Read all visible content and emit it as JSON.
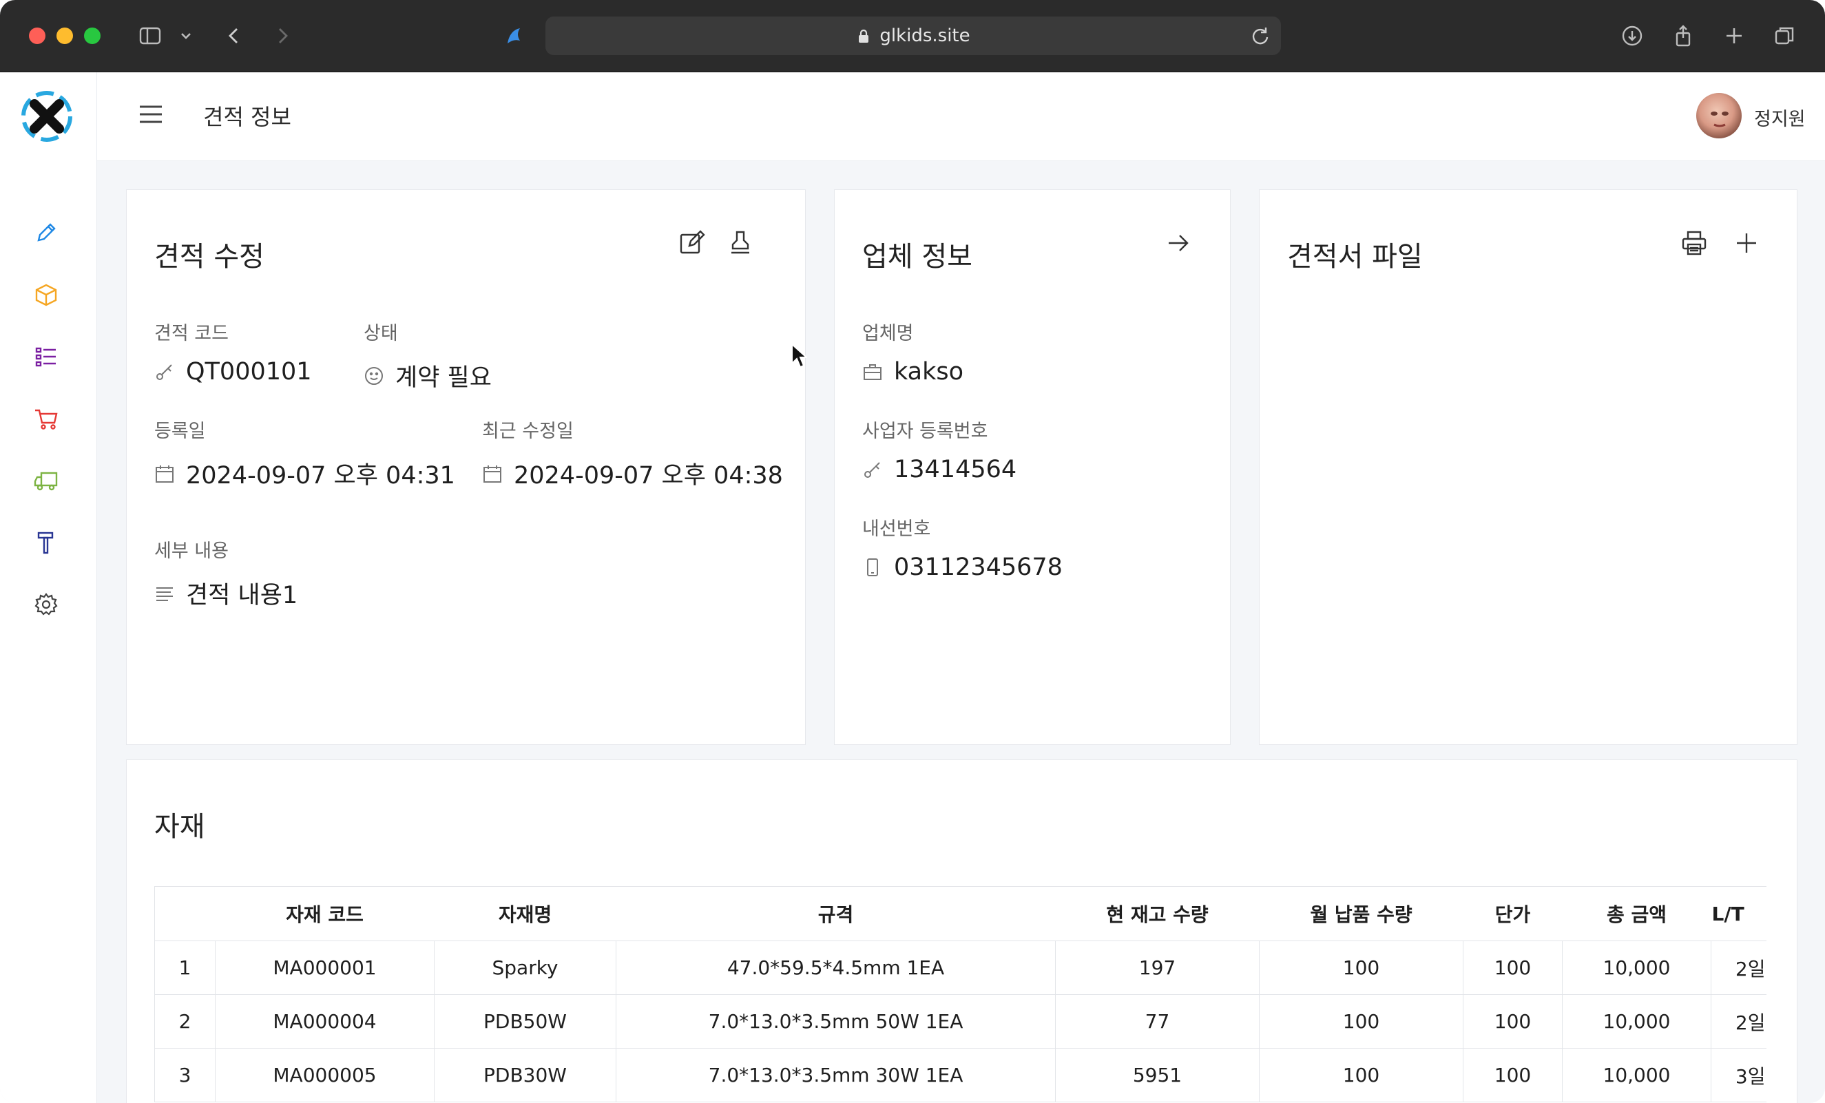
{
  "browser": {
    "url": "glkids.site"
  },
  "header": {
    "title": "견적 정보",
    "user_name": "정지원"
  },
  "sidebar": {
    "items": [
      {
        "icon": "pencil-icon",
        "color": "#1e88e5"
      },
      {
        "icon": "box-icon",
        "color": "#f5a623"
      },
      {
        "icon": "list-icon",
        "color": "#7b1fa2"
      },
      {
        "icon": "cart-icon",
        "color": "#e53935"
      },
      {
        "icon": "truck-icon",
        "color": "#7cb342"
      },
      {
        "icon": "hammer-icon",
        "color": "#283593"
      },
      {
        "icon": "gear-icon",
        "color": "#424242"
      }
    ]
  },
  "quote_card": {
    "title": "견적 수정",
    "code_label": "견적 코드",
    "code_value": "QT000101",
    "status_label": "상태",
    "status_value": "계약 필요",
    "created_label": "등록일",
    "created_value": "2024-09-07 오후 04:31",
    "modified_label": "최근 수정일",
    "modified_value": "2024-09-07 오후 04:38",
    "detail_label": "세부 내용",
    "detail_value": "견적 내용1"
  },
  "company_card": {
    "title": "업체 정보",
    "name_label": "업체명",
    "name_value": "kakso",
    "bizno_label": "사업자 등록번호",
    "bizno_value": "13414564",
    "phone_label": "내선번호",
    "phone_value": "03112345678"
  },
  "file_card": {
    "title": "견적서 파일"
  },
  "materials": {
    "title": "자재",
    "columns": [
      "",
      "자재 코드",
      "자재명",
      "규격",
      "현 재고 수량",
      "월 납품 수량",
      "단가",
      "총 금액",
      "L/T"
    ],
    "rows": [
      [
        "1",
        "MA000001",
        "Sparky",
        "47.0*59.5*4.5mm 1EA",
        "197",
        "100",
        "100",
        "10,000",
        "2일"
      ],
      [
        "2",
        "MA000004",
        "PDB50W",
        "7.0*13.0*3.5mm 50W 1EA",
        "77",
        "100",
        "100",
        "10,000",
        "2일"
      ],
      [
        "3",
        "MA000005",
        "PDB30W",
        "7.0*13.0*3.5mm 30W 1EA",
        "5951",
        "100",
        "100",
        "10,000",
        "3일"
      ]
    ]
  }
}
